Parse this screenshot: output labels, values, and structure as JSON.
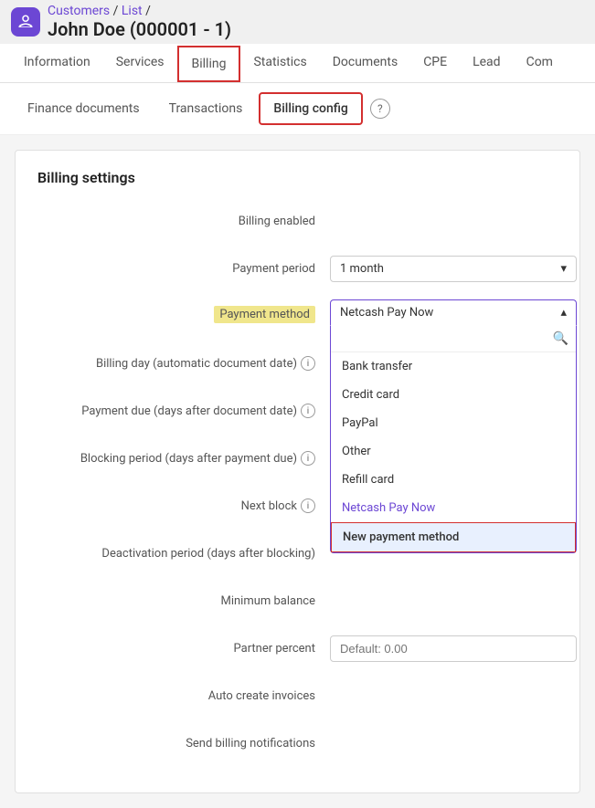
{
  "breadcrumb": {
    "items": [
      "Customers",
      "List",
      ""
    ],
    "separator": "/"
  },
  "page_title": "John Doe (000001 - 1)",
  "app_icon": "👤",
  "main_tabs": [
    {
      "label": "Information",
      "id": "information",
      "active": false
    },
    {
      "label": "Services",
      "id": "services",
      "active": false
    },
    {
      "label": "Billing",
      "id": "billing",
      "active": true
    },
    {
      "label": "Statistics",
      "id": "statistics",
      "active": false
    },
    {
      "label": "Documents",
      "id": "documents",
      "active": false
    },
    {
      "label": "CPE",
      "id": "cpe",
      "active": false
    },
    {
      "label": "Lead",
      "id": "lead",
      "active": false
    },
    {
      "label": "Com",
      "id": "com",
      "active": false
    }
  ],
  "sub_tabs": [
    {
      "label": "Finance documents",
      "id": "finance-documents",
      "active": false
    },
    {
      "label": "Transactions",
      "id": "transactions",
      "active": false
    },
    {
      "label": "Billing config",
      "id": "billing-config",
      "active": true
    }
  ],
  "section_title": "Billing settings",
  "fields": {
    "billing_enabled": {
      "label": "Billing enabled",
      "value": true
    },
    "payment_period": {
      "label": "Payment period",
      "value": "1 month"
    },
    "payment_method": {
      "label": "Payment method",
      "value": "Netcash Pay Now"
    },
    "billing_day": {
      "label": "Billing day (automatic document date)"
    },
    "payment_due": {
      "label": "Payment due (days after document date)"
    },
    "blocking_period": {
      "label": "Blocking period (days after payment due)"
    },
    "next_block": {
      "label": "Next block"
    },
    "deactivation_period": {
      "label": "Deactivation period (days after blocking)"
    },
    "minimum_balance": {
      "label": "Minimum balance"
    },
    "partner_percent": {
      "label": "Partner percent",
      "placeholder": "Default: 0.00"
    },
    "auto_create_invoices": {
      "label": "Auto create invoices",
      "value": false
    },
    "send_billing_notifications": {
      "label": "Send billing notifications",
      "value": true
    }
  },
  "dropdown": {
    "search_placeholder": "",
    "items": [
      {
        "label": "Bank transfer",
        "id": "bank-transfer"
      },
      {
        "label": "Credit card",
        "id": "credit-card"
      },
      {
        "label": "PayPal",
        "id": "paypal"
      },
      {
        "label": "Other",
        "id": "other"
      },
      {
        "label": "Refill card",
        "id": "refill-card"
      },
      {
        "label": "Netcash Pay Now",
        "id": "netcash-pay-now",
        "is_link": true
      },
      {
        "label": "New payment method",
        "id": "new-payment-method",
        "highlighted": true
      }
    ]
  },
  "icons": {
    "chevron_down": "▾",
    "chevron_up": "▴",
    "search": "🔍",
    "question": "?",
    "info": "i"
  }
}
